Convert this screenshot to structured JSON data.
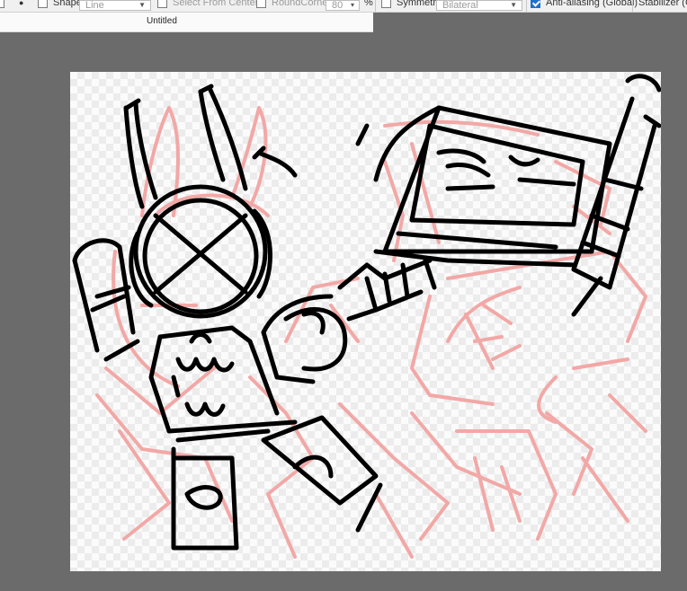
{
  "toolbar": {
    "shape_label": "Shape",
    "shape_value": "Line",
    "select_from_center_label": "Select From Center",
    "roundcorner_label": "RoundCorner",
    "roundcorner_value": "80",
    "roundcorner_unit": "%",
    "symmetry_label": "Symmetry",
    "symmetry_value": "Bilateral",
    "antialiasing_label": "Anti-aliasing (Global)",
    "antialiasing_checked": true,
    "stabilizer_label": "Stabilizer (Gl"
  },
  "document": {
    "tab_title": "Untitled"
  },
  "colors": {
    "workspace": "#6b6b6b",
    "sketch_pink": "#f2a8a6",
    "ink_black": "#000000",
    "accent": "#1f6fd1"
  }
}
